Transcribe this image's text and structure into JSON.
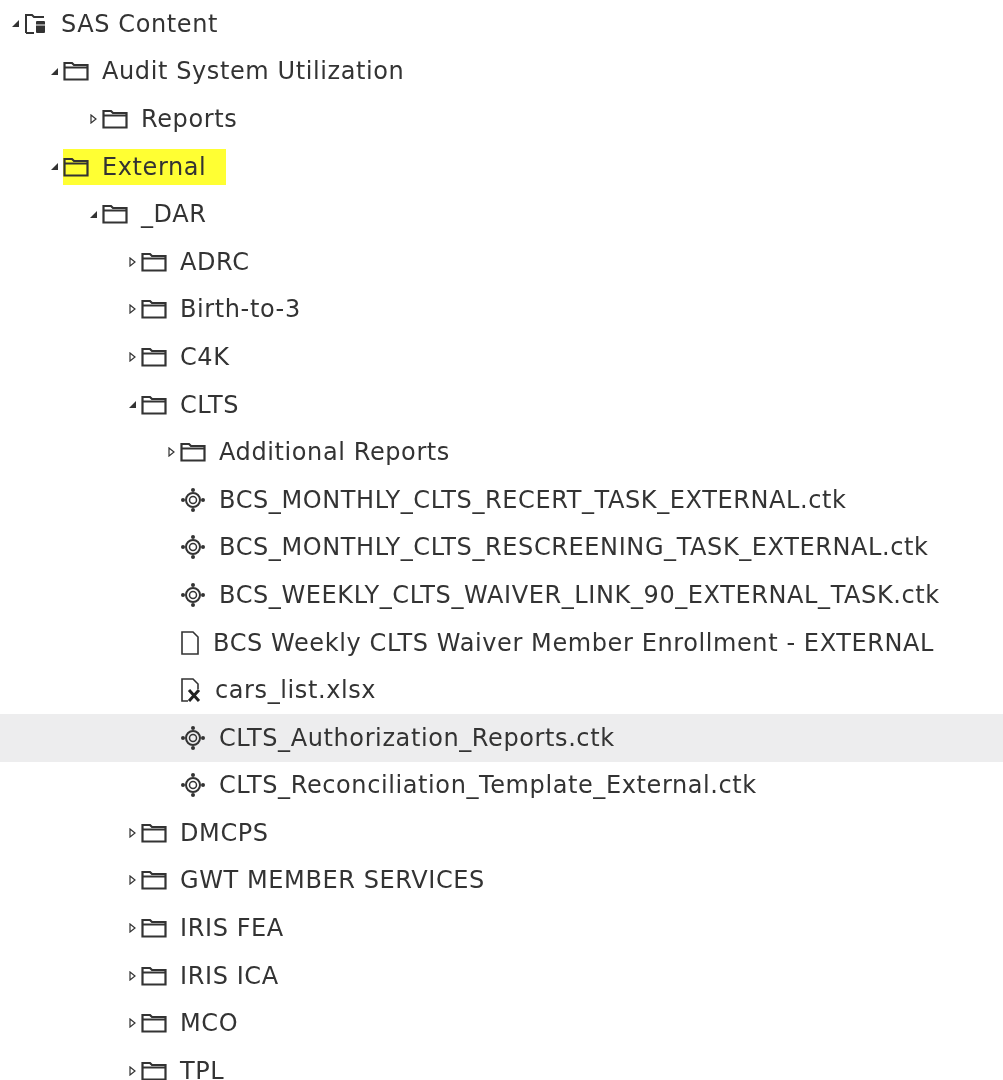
{
  "tree": [
    {
      "kind": "root",
      "label": "SAS Content",
      "expanded": true,
      "selected": false,
      "highlighted": false,
      "children": [
        {
          "kind": "folder",
          "label": "Audit System Utilization",
          "expanded": true,
          "selected": false,
          "highlighted": false,
          "children": [
            {
              "kind": "folder",
              "label": "Reports",
              "expanded": false,
              "selected": false,
              "highlighted": false
            }
          ]
        },
        {
          "kind": "folder",
          "label": "External",
          "expanded": true,
          "selected": false,
          "highlighted": true,
          "children": [
            {
              "kind": "folder",
              "label": "_DAR",
              "expanded": true,
              "selected": false,
              "highlighted": false,
              "children": [
                {
                  "kind": "folder",
                  "label": "ADRC",
                  "expanded": false,
                  "selected": false,
                  "highlighted": false
                },
                {
                  "kind": "folder",
                  "label": "Birth-to-3",
                  "expanded": false,
                  "selected": false,
                  "highlighted": false
                },
                {
                  "kind": "folder",
                  "label": "C4K",
                  "expanded": false,
                  "selected": false,
                  "highlighted": false
                },
                {
                  "kind": "folder",
                  "label": "CLTS",
                  "expanded": true,
                  "selected": false,
                  "highlighted": false,
                  "children": [
                    {
                      "kind": "folder",
                      "label": "Additional Reports",
                      "expanded": false,
                      "selected": false,
                      "highlighted": false
                    },
                    {
                      "kind": "task",
                      "label": "BCS_MONTHLY_CLTS_RECERT_TASK_EXTERNAL.ctk",
                      "selected": false,
                      "highlighted": false
                    },
                    {
                      "kind": "task",
                      "label": "BCS_MONTHLY_CLTS_RESCREENING_TASK_EXTERNAL.ctk",
                      "selected": false,
                      "highlighted": false
                    },
                    {
                      "kind": "task",
                      "label": "BCS_WEEKLY_CLTS_WAIVER_LINK_90_EXTERNAL_TASK.ctk",
                      "selected": false,
                      "highlighted": false
                    },
                    {
                      "kind": "report",
                      "label": "BCS Weekly CLTS Waiver Member Enrollment - EXTERNAL",
                      "selected": false,
                      "highlighted": false
                    },
                    {
                      "kind": "spreadsheet",
                      "label": "cars_list.xlsx",
                      "selected": false,
                      "highlighted": false
                    },
                    {
                      "kind": "task",
                      "label": "CLTS_Authorization_Reports.ctk",
                      "selected": true,
                      "highlighted": false
                    },
                    {
                      "kind": "task",
                      "label": "CLTS_Reconciliation_Template_External.ctk",
                      "selected": false,
                      "highlighted": false
                    }
                  ]
                },
                {
                  "kind": "folder",
                  "label": "DMCPS",
                  "expanded": false,
                  "selected": false,
                  "highlighted": false
                },
                {
                  "kind": "folder",
                  "label": "GWT MEMBER SERVICES",
                  "expanded": false,
                  "selected": false,
                  "highlighted": false
                },
                {
                  "kind": "folder",
                  "label": "IRIS FEA",
                  "expanded": false,
                  "selected": false,
                  "highlighted": false
                },
                {
                  "kind": "folder",
                  "label": "IRIS ICA",
                  "expanded": false,
                  "selected": false,
                  "highlighted": false
                },
                {
                  "kind": "folder",
                  "label": "MCO",
                  "expanded": false,
                  "selected": false,
                  "highlighted": false
                },
                {
                  "kind": "folder",
                  "label": "TPL",
                  "expanded": false,
                  "selected": false,
                  "highlighted": false
                }
              ]
            }
          ]
        }
      ]
    }
  ]
}
